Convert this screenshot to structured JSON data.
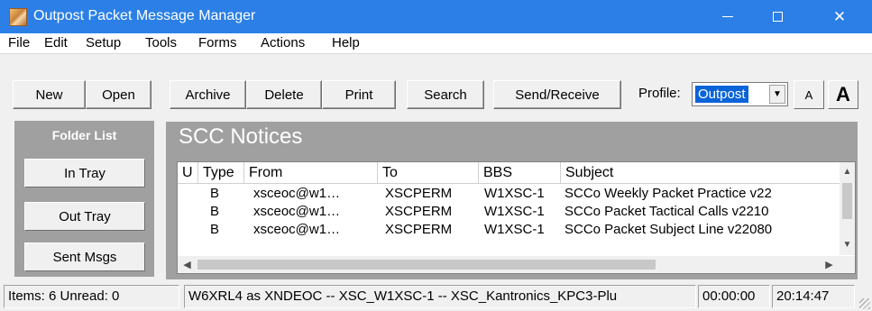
{
  "window": {
    "title": "Outpost Packet Message Manager",
    "minimize_icon": "minimize-icon",
    "maximize_icon": "maximize-icon",
    "close_glyph": "✕"
  },
  "menu": [
    "File",
    "Edit",
    "Setup",
    "Tools",
    "Forms",
    "Actions",
    "Help"
  ],
  "toolbar": {
    "buttons": [
      "New",
      "Open",
      "Archive",
      "Delete",
      "Print",
      "Search",
      "Send/Receive"
    ],
    "profile_label": "Profile:",
    "profile_value": "Outpost",
    "font_small": "A",
    "font_large": "A"
  },
  "folders": {
    "title": "Folder List",
    "items": [
      "In Tray",
      "Out Tray",
      "Sent Msgs"
    ]
  },
  "current_folder": "SCC Notices",
  "message_list": {
    "columns": [
      "U",
      "Type",
      "From",
      "To",
      "BBS",
      "Subject"
    ],
    "rows": [
      {
        "u": "",
        "type": "B",
        "from": "xsceoc@w1…",
        "to": "XSCPERM",
        "bbs": "W1XSC-1",
        "subject": "SCCo Weekly Packet Practice v22"
      },
      {
        "u": "",
        "type": "B",
        "from": "xsceoc@w1…",
        "to": "XSCPERM",
        "bbs": "W1XSC-1",
        "subject": "SCCo Packet Tactical Calls v2210"
      },
      {
        "u": "",
        "type": "B",
        "from": "xsceoc@w1…",
        "to": "XSCPERM",
        "bbs": "W1XSC-1",
        "subject": "SCCo Packet Subject Line v22080"
      }
    ]
  },
  "status": {
    "counts": "Items: 6  Unread: 0",
    "connection": "W6XRL4 as XNDEOC -- XSC_W1XSC-1 -- XSC_Kantronics_KPC3-Plu",
    "elapsed": "00:00:00",
    "clock": "20:14:47"
  }
}
